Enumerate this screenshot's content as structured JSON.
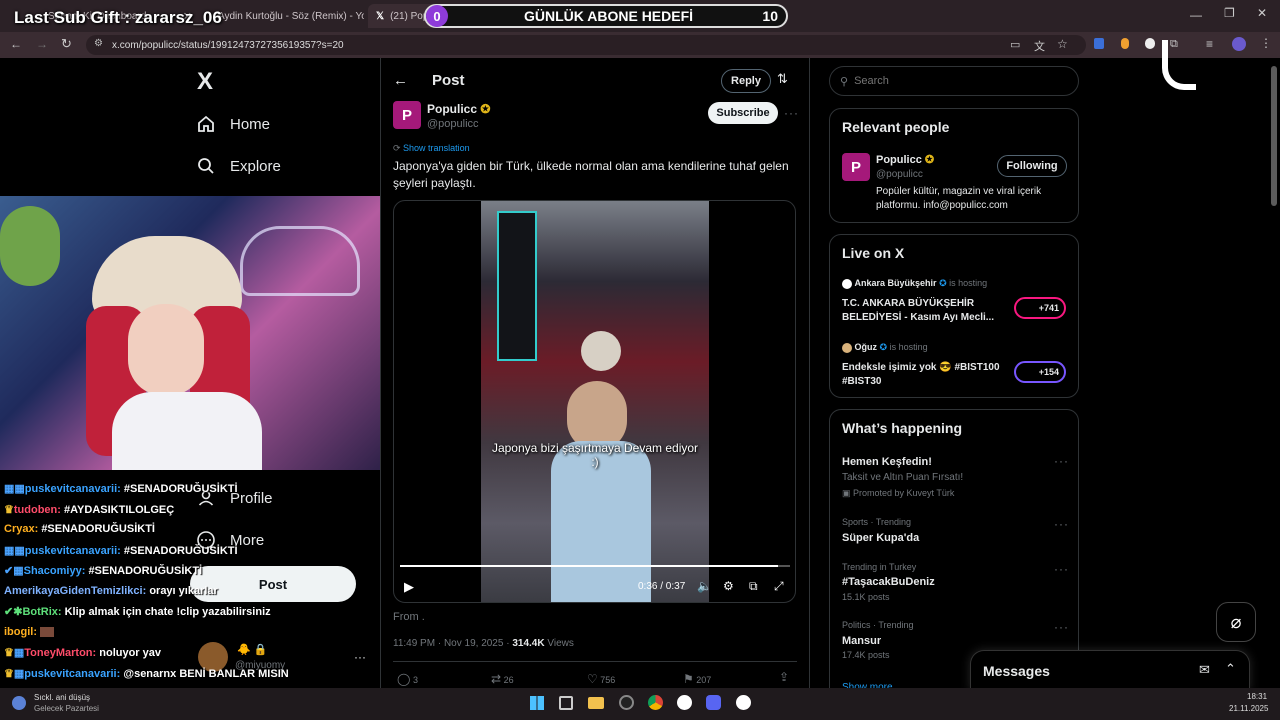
{
  "browser": {
    "tabs": [
      {
        "label": "Stream Kit Dashboard"
      },
      {
        "label": "Aydin Kurtoğlu - Söz (Remix) - You..."
      },
      {
        "label": "(21) Populicc on X: \"Japonya'ya gi..."
      }
    ],
    "url": "x.com/populicc/status/1991247372735619357?s=20"
  },
  "stream": {
    "last_sub_gift": "Last Sub Gift : zararsz_06",
    "goal_current": "0",
    "goal_label": "GÜNLÜK ABONE HEDEFİ",
    "goal_target": "10",
    "chat": [
      {
        "user": "puskevitcanavarii:",
        "msg": "#SENADORUĞUSİKTİ",
        "color": "#3aa3ff"
      },
      {
        "user": "tudoben:",
        "msg": "#AYDASIKTILOLGEÇ",
        "color": "#ff4d6a"
      },
      {
        "user": "Cryax:",
        "msg": "#SENADORUĞUSİKTİ",
        "color": "#ffb020"
      },
      {
        "user": "puskevitcanavarii:",
        "msg": "#SENADORUĞUSİKTİ",
        "color": "#3aa3ff"
      },
      {
        "user": "Shacomiyy:",
        "msg": "#SENADORUĞUSİKTİ",
        "color": "#3aa3ff"
      },
      {
        "user": "AmerikayaGidenTemizlikci:",
        "msg": "orayı yıkarlar",
        "color": "#7fb2ff"
      },
      {
        "user": "BotRix:",
        "msg": "Klip almak için chate !clip yazabilirsiniz",
        "color": "#5ee07a"
      },
      {
        "user": "ibogil:",
        "msg": "",
        "color": "#ffb020"
      },
      {
        "user": "ToneyMarton:",
        "msg": "noluyor yav",
        "color": "#ff4d6a"
      },
      {
        "user": "puskevitcanavarii:",
        "msg": "@senarnx BENİ BANLAR MISIN",
        "color": "#3aa3ff"
      }
    ]
  },
  "nav": {
    "logo": "X",
    "home": "Home",
    "explore": "Explore",
    "profile": "Profile",
    "more": "More",
    "post": "Post",
    "account_handle": "@miyuomy"
  },
  "post": {
    "header_title": "Post",
    "reply_btn": "Reply",
    "author_name": "Populicc",
    "author_handle": "@populicc",
    "subscribe": "Subscribe",
    "show_translation": "Show translation",
    "text": "Japonya'ya giden bir Türk, ülkede normal olan ama kendilerine tuhaf gelen şeyleri paylaştı.",
    "video_caption": "Japonya bizi şaşırtmaya Devam ediyor :)",
    "video_time": "0:36 / 0:37",
    "from": "From .",
    "timestamp": "11:49 PM · Nov 19, 2025 · ",
    "views_count": "314.4K",
    "views_label": " Views",
    "stats": {
      "replies": "3",
      "reposts": "26",
      "likes": "756",
      "bookmarks": "207"
    }
  },
  "right": {
    "search_placeholder": "Search",
    "relevant_title": "Relevant people",
    "relevant_name": "Populicc",
    "relevant_handle": "@populicc",
    "following": "Following",
    "relevant_bio": "Popüler kültür, magazin ve viral içerik platformu. info@populicc.com",
    "live_title": "Live on X",
    "live": [
      {
        "host": "Ankara Büyükşehir",
        "hosting": "is hosting",
        "title": "T.C. ANKARA BÜYÜKŞEHİR BELEDİYESİ - Kasım Ayı Mecli...",
        "count": "+741"
      },
      {
        "host": "Oğuz",
        "hosting": "is hosting",
        "title": "Endeksle işimiz yok 😎 #BIST100 #BIST30",
        "count": "+154"
      }
    ],
    "happening_title": "What’s happening",
    "trends": [
      {
        "meta": "",
        "name": "Hemen Keşfedin!",
        "sub": "Taksit ve Altın Puan Fırsatı!",
        "promo": "Promoted by Kuveyt Türk"
      },
      {
        "meta": "Sports · Trending",
        "name": "Süper Kupa'da",
        "sub": "",
        "promo": ""
      },
      {
        "meta": "Trending in Turkey",
        "name": "#TaşacakBuDeniz",
        "sub": "15.1K posts",
        "promo": ""
      },
      {
        "meta": "Politics · Trending",
        "name": "Mansur",
        "sub": "17.4K posts",
        "promo": ""
      }
    ],
    "show_more": "Show more",
    "messages": "Messages"
  },
  "taskbar": {
    "weather_title": "Sıckl. ani düşüş",
    "weather_sub": "Gelecek Pazartesi",
    "time": "18:31",
    "date": "21.11.2025"
  }
}
